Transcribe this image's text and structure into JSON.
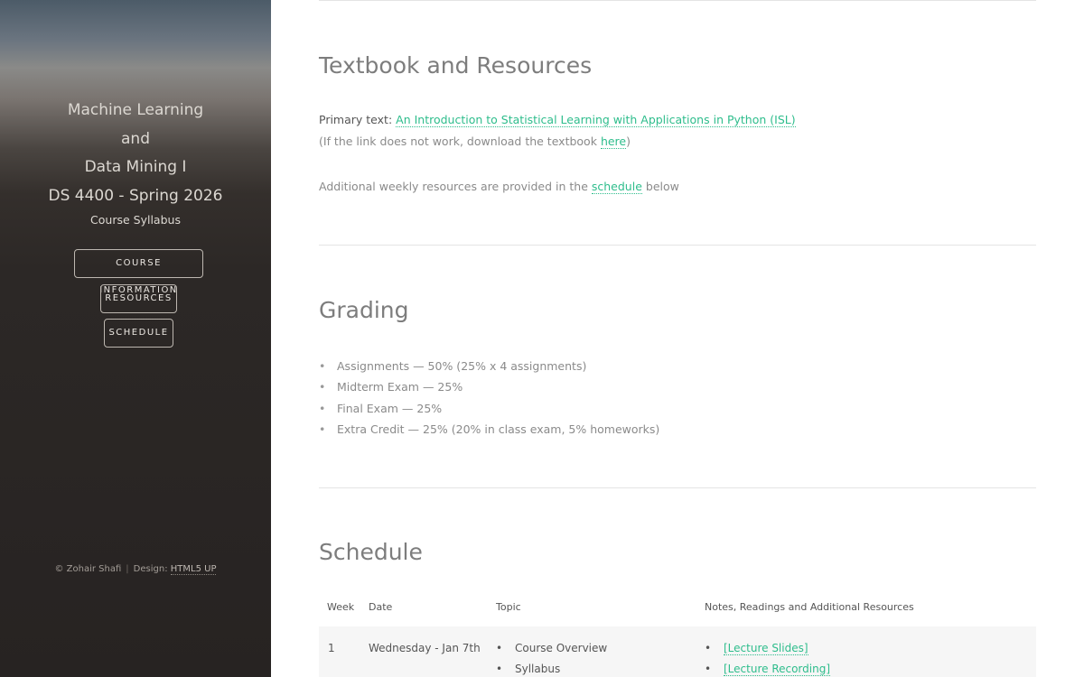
{
  "sidebar": {
    "title_lines": [
      "Machine Learning",
      "and",
      "Data Mining I",
      "DS 4400 - Spring 2026"
    ],
    "subtitle": "Course Syllabus",
    "nav": [
      {
        "label": "Course Information"
      },
      {
        "label": "Resources"
      },
      {
        "label": "Schedule"
      }
    ],
    "footer": {
      "copyright": "© Zohair Shafi",
      "design_prefix": "Design:",
      "design_link": "HTML5 UP"
    }
  },
  "textbook": {
    "heading": "Textbook and Resources",
    "primary_prefix": "Primary text:",
    "primary_link": "An Introduction to Statistical Learning with Applications in Python (ISL)",
    "fallback_prefix": "(If the link does not work, download the textbook",
    "fallback_link": "here",
    "fallback_suffix": ")",
    "additional_prefix": "Additional weekly resources are provided in the",
    "additional_link": "schedule",
    "additional_suffix": "below"
  },
  "grading": {
    "heading": "Grading",
    "items": [
      "Assignments — 50% (25% x 4 assignments)",
      "Midterm Exam — 25%",
      "Final Exam — 25%",
      "Extra Credit — 25% (20% in class exam, 5% homeworks)"
    ]
  },
  "schedule": {
    "heading": "Schedule",
    "columns": [
      "Week",
      "Date",
      "Topic",
      "Notes, Readings and Additional Resources"
    ],
    "rows": [
      {
        "week": "1",
        "date": "Wednesday - Jan 7th",
        "topics": [
          "Course Overview",
          "Syllabus"
        ],
        "notes": [
          "[Lecture Slides]",
          "[Lecture Recording]"
        ]
      }
    ]
  },
  "colors": {
    "accent": "#2ebd8c",
    "sidebar_dark": "#272322"
  }
}
